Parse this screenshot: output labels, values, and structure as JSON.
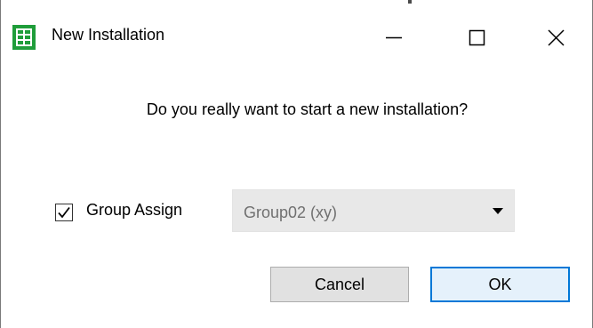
{
  "window": {
    "title": "New Installation",
    "icon": "grid-app-icon",
    "controls": {
      "minimize": "minimize-icon",
      "maximize": "maximize-icon",
      "close": "close-icon"
    }
  },
  "dialog": {
    "question": "Do you really want to start a new installation?",
    "group_assign": {
      "label": "Group Assign",
      "checked": true,
      "selected_value": "Group02 (xy)"
    },
    "buttons": {
      "cancel_label": "Cancel",
      "ok_label": "OK"
    }
  },
  "colors": {
    "icon_green": "#1f9d3a",
    "accent_blue": "#0078d7",
    "ok_fill": "#e5f1fb",
    "button_fill": "#e1e1e1",
    "combo_fill": "#e8e8e8"
  }
}
